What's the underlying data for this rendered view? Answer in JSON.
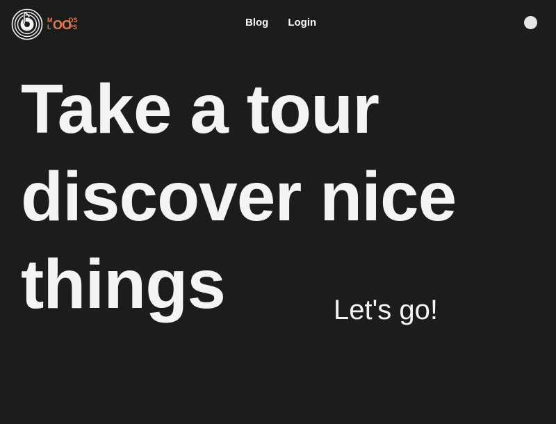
{
  "colors": {
    "background": "#1c1c1c",
    "text": "#f4f4f4",
    "brand": "#e07a55",
    "toggle": "#e6e6e6"
  },
  "logo": {
    "icon": "vinyl-record-icon",
    "text_m": "M",
    "text_l": "L",
    "text_oo": "OO",
    "text_ds": "DS",
    "text_ps": "PS"
  },
  "nav": {
    "items": [
      {
        "label": "Blog"
      },
      {
        "label": "Login"
      }
    ]
  },
  "theme_toggle": {
    "icon": "circle-icon"
  },
  "hero": {
    "title_lines": [
      "Take a tour",
      "discover nice",
      "things"
    ],
    "cta_label": "Let's go!"
  }
}
